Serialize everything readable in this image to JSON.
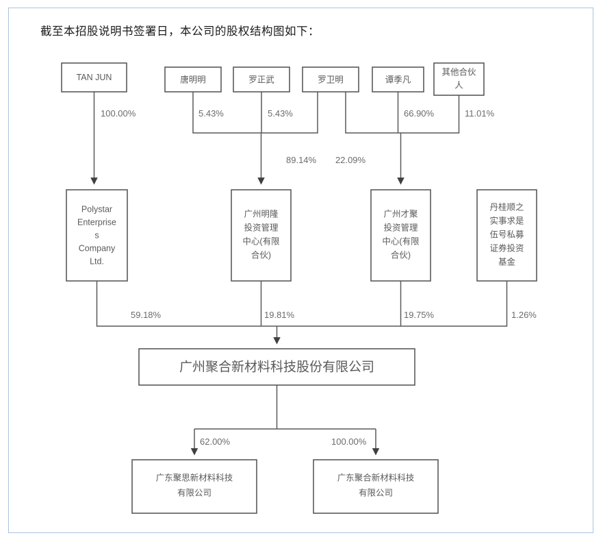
{
  "document": {
    "caption": "截至本招股说明书签署日，本公司的股权结构图如下："
  },
  "colors": {
    "page_border": "#a8c2dd",
    "box_stroke": "#595959",
    "text": "#5a5a5a",
    "label_text": "#6b6b6b",
    "background": "#ffffff"
  },
  "diagram": {
    "type": "equity-structure-org-chart",
    "tier1_shareholders": [
      {
        "id": "tan-jun",
        "label": "TAN JUN",
        "script": "latin"
      },
      {
        "id": "tang-mingming",
        "label": "唐明明",
        "script": "han"
      },
      {
        "id": "luo-zhengwu",
        "label": "罗正武",
        "script": "han"
      },
      {
        "id": "luo-weiming",
        "label": "罗卫明",
        "script": "han"
      },
      {
        "id": "tan-jifan",
        "label": "谭季凡",
        "script": "han"
      },
      {
        "id": "other-partners",
        "label": "其他合伙\n人",
        "script": "han"
      }
    ],
    "tier2_holdings": [
      {
        "id": "polystar",
        "label": "Polystar\nEnterprise\ns\nCompany\nLtd.",
        "script": "latin"
      },
      {
        "id": "guangzhou-minglong",
        "label": "广州明隆\n投资管理\n中心(有限\n合伙)",
        "script": "han"
      },
      {
        "id": "guangzhou-caiju",
        "label": "广州才聚\n投资管理\n中心(有限\n合伙)",
        "script": "han"
      },
      {
        "id": "dangui-fund",
        "label": "丹桂顺之\n实事求是\n伍号私募\n证券投资\n基金",
        "script": "han"
      }
    ],
    "issuer": {
      "id": "issuer",
      "label": "广州聚合新材料科技股份有限公司"
    },
    "tier4_subsidiaries": [
      {
        "id": "guangdong-jusi",
        "label": "广东聚思新材料科技\n有限公司"
      },
      {
        "id": "guangdong-juhe",
        "label": "广东聚合新材料科技\n有限公司"
      }
    ],
    "edges": [
      {
        "from": "tan-jun",
        "to": "polystar",
        "percent": "100.00%"
      },
      {
        "from": "tang-mingming",
        "to": "guangzhou-minglong-bus",
        "percent": "5.43%"
      },
      {
        "from": "luo-zhengwu",
        "to": "guangzhou-minglong-bus",
        "percent": "5.43%"
      },
      {
        "from": "luo-weiming",
        "to": "guangzhou-minglong",
        "percent": "89.14%"
      },
      {
        "from": "luo-weiming",
        "to": "guangzhou-caiju",
        "percent": "22.09%"
      },
      {
        "from": "tan-jifan",
        "to": "guangzhou-caiju",
        "percent": "66.90%"
      },
      {
        "from": "other-partners",
        "to": "guangzhou-caiju",
        "percent": "11.01%"
      },
      {
        "from": "polystar",
        "to": "issuer",
        "percent": "59.18%"
      },
      {
        "from": "guangzhou-minglong",
        "to": "issuer",
        "percent": "19.81%"
      },
      {
        "from": "guangzhou-caiju",
        "to": "issuer",
        "percent": "19.75%"
      },
      {
        "from": "dangui-fund",
        "to": "issuer",
        "percent": "1.26%"
      },
      {
        "from": "issuer",
        "to": "guangdong-jusi",
        "percent": "62.00%"
      },
      {
        "from": "issuer",
        "to": "guangdong-juhe",
        "percent": "100.00%"
      }
    ],
    "percent_labels": {
      "p_tanjun": "100.00%",
      "p_tangmingming": "5.43%",
      "p_luozhengwu": "5.43%",
      "p_minglong_in": "89.14%",
      "p_caiju_in": "22.09%",
      "p_tanjifan": "66.90%",
      "p_other": "11.01%",
      "p_polystar_issuer": "59.18%",
      "p_minglong_issuer": "19.81%",
      "p_caiju_issuer": "19.75%",
      "p_dangui_issuer": "1.26%",
      "p_jusi": "62.00%",
      "p_juhe": "100.00%"
    }
  }
}
